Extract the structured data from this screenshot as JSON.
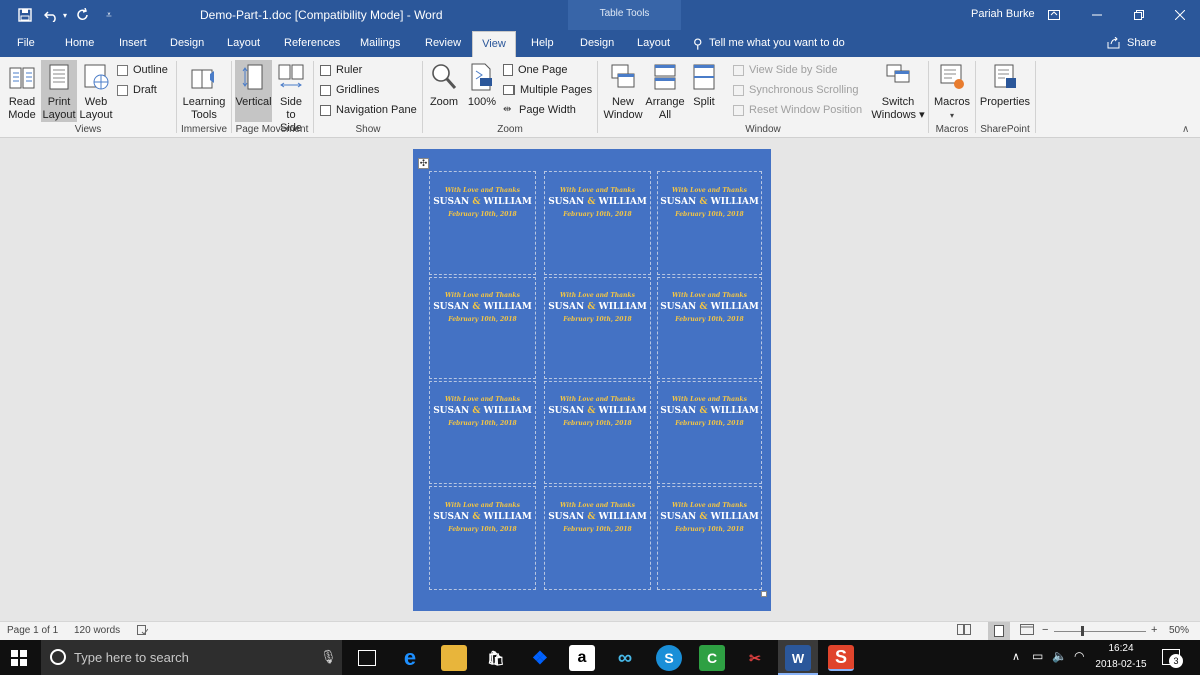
{
  "titlebar": {
    "title": "Demo-Part-1.doc [Compatibility Mode]  -  Word",
    "user": "Pariah Burke",
    "context_group": "Table Tools",
    "icons": [
      "save-icon",
      "undo-icon",
      "redo-icon",
      "customize-qat-icon",
      "ribbon-display-options-icon",
      "minimize-icon",
      "restore-icon",
      "close-icon"
    ]
  },
  "tabs": {
    "file": "File",
    "home": "Home",
    "insert": "Insert",
    "design": "Design",
    "layout": "Layout",
    "references": "References",
    "mailings": "Mailings",
    "review": "Review",
    "view": "View",
    "help": "Help",
    "table_design": "Design",
    "table_layout": "Layout",
    "tell_me": "Tell me what you want to do",
    "share": "Share"
  },
  "ribbon": {
    "views": {
      "label": "Views",
      "read_mode": [
        "Read",
        "Mode"
      ],
      "print_layout": [
        "Print",
        "Layout"
      ],
      "web_layout": [
        "Web",
        "Layout"
      ],
      "outline": "Outline",
      "draft": "Draft"
    },
    "immersive": {
      "label": "Immersive",
      "learning_tools": [
        "Learning",
        "Tools"
      ]
    },
    "page_movement": {
      "label": "Page Movement",
      "vertical": "Vertical",
      "side_to_side": [
        "Side",
        "to Side"
      ]
    },
    "show": {
      "label": "Show",
      "ruler": "Ruler",
      "gridlines": "Gridlines",
      "navigation_pane": "Navigation Pane"
    },
    "zoom": {
      "label": "Zoom",
      "zoom": "Zoom",
      "hundred": "100%",
      "one_page": "One Page",
      "multiple_pages": "Multiple Pages",
      "page_width": "Page Width"
    },
    "window": {
      "label": "Window",
      "new_window": [
        "New",
        "Window"
      ],
      "arrange_all": [
        "Arrange",
        "All"
      ],
      "split": "Split",
      "view_side_by_side": "View Side by Side",
      "sync_scrolling": "Synchronous Scrolling",
      "reset_window": "Reset Window Position",
      "switch_windows": [
        "Switch",
        "Windows ▾"
      ]
    },
    "macros": {
      "label": "Macros",
      "macros": "Macros"
    },
    "sharepoint": {
      "label": "SharePoint",
      "properties": "Properties"
    }
  },
  "document": {
    "card": {
      "line1": "With Love and Thanks",
      "name1": "SUSAN",
      "amp": "&",
      "name2": "WILLIAM",
      "date": "February 10th, 2018"
    },
    "colors": {
      "page_bg": "#4472c4",
      "accent": "#f3c544"
    }
  },
  "status": {
    "page": "Page 1 of 1",
    "words": "120 words",
    "zoom": "50%",
    "zoom_level": 0.5
  },
  "taskbar": {
    "search_placeholder": "Type here to search",
    "time": "16:24",
    "date": "2018-02-15",
    "notification_count": "3"
  }
}
